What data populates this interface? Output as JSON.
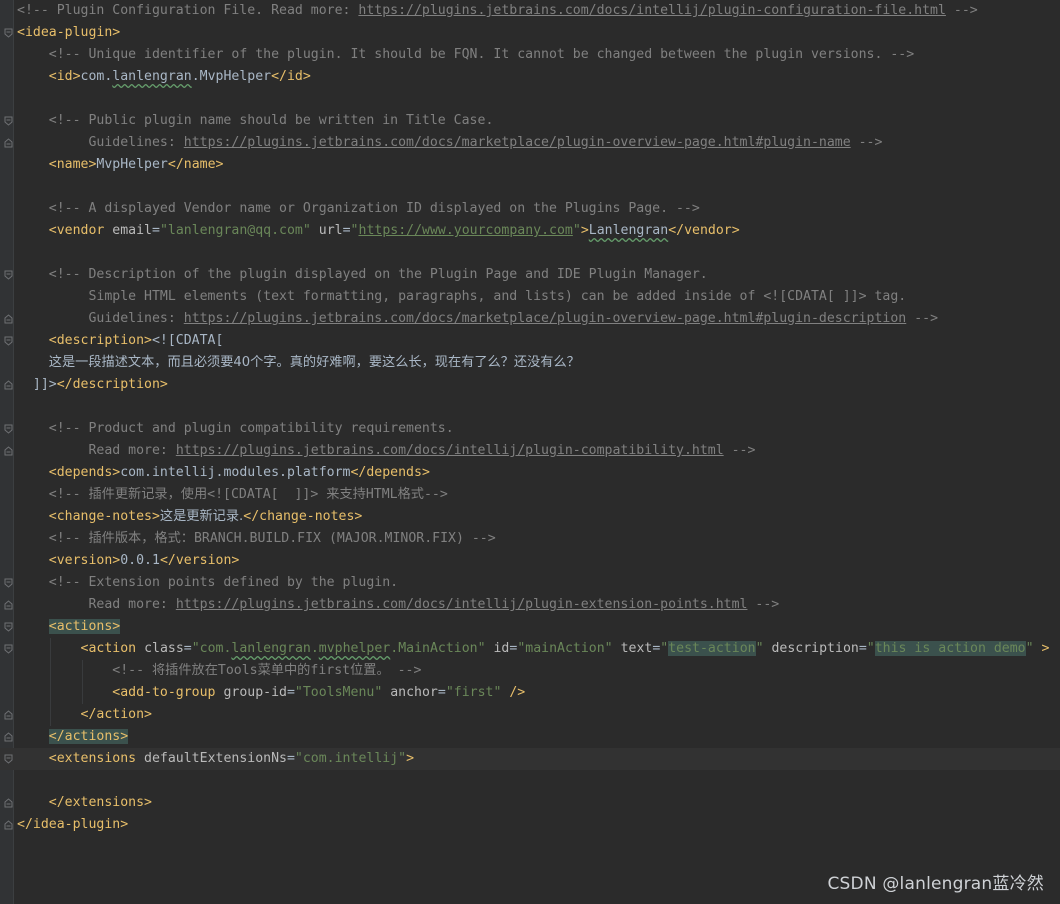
{
  "editor": {
    "language": "xml",
    "caret_line": 34,
    "lines": [
      [
        {
          "c": "cmt",
          "t": "<!-- Plugin Configuration File. Read more: "
        },
        {
          "c": "link",
          "t": "https://plugins.jetbrains.com/docs/intellij/plugin-configuration-file.html"
        },
        {
          "c": "cmt",
          "t": " -->"
        }
      ],
      [
        {
          "c": "tag",
          "t": "<idea-plugin>"
        }
      ],
      [
        {
          "c": "ws",
          "t": "    "
        },
        {
          "c": "cmt",
          "t": "<!-- Unique identifier of the plugin. It should be FQN. It cannot be changed between the plugin versions. -->"
        }
      ],
      [
        {
          "c": "ws",
          "t": "    "
        },
        {
          "c": "tag",
          "t": "<id>"
        },
        {
          "c": "text",
          "t": "com."
        },
        {
          "c": "typo",
          "t": "lanlengran"
        },
        {
          "c": "text",
          "t": ".MvpHelper"
        },
        {
          "c": "tag",
          "t": "</id>"
        }
      ],
      [],
      [
        {
          "c": "ws",
          "t": "    "
        },
        {
          "c": "cmt",
          "t": "<!-- Public plugin name should be written in Title Case."
        }
      ],
      [
        {
          "c": "ws",
          "t": "         "
        },
        {
          "c": "cmt",
          "t": "Guidelines: "
        },
        {
          "c": "link",
          "t": "https://plugins.jetbrains.com/docs/marketplace/plugin-overview-page.html#plugin-name"
        },
        {
          "c": "cmt",
          "t": " -->"
        }
      ],
      [
        {
          "c": "ws",
          "t": "    "
        },
        {
          "c": "tag",
          "t": "<name>"
        },
        {
          "c": "text",
          "t": "MvpHelper"
        },
        {
          "c": "tag",
          "t": "</name>"
        }
      ],
      [],
      [
        {
          "c": "ws",
          "t": "    "
        },
        {
          "c": "cmt",
          "t": "<!-- A displayed Vendor name or Organization ID displayed on the Plugins Page. -->"
        }
      ],
      [
        {
          "c": "ws",
          "t": "    "
        },
        {
          "c": "tag",
          "t": "<vendor "
        },
        {
          "c": "attr",
          "t": "email"
        },
        {
          "c": "text",
          "t": "="
        },
        {
          "c": "val",
          "t": "\"lanlengran@qq.com\""
        },
        {
          "c": "text",
          "t": " "
        },
        {
          "c": "attr",
          "t": "url"
        },
        {
          "c": "text",
          "t": "="
        },
        {
          "c": "val",
          "t": "\""
        },
        {
          "c": "linkval",
          "t": "https://www.yourcompany.com"
        },
        {
          "c": "val",
          "t": "\""
        },
        {
          "c": "tag",
          "t": ">"
        },
        {
          "c": "typo",
          "t": "Lanlengran"
        },
        {
          "c": "tag",
          "t": "</vendor>"
        }
      ],
      [],
      [
        {
          "c": "ws",
          "t": "    "
        },
        {
          "c": "cmt",
          "t": "<!-- Description of the plugin displayed on the Plugin Page and IDE Plugin Manager."
        }
      ],
      [
        {
          "c": "ws",
          "t": "         "
        },
        {
          "c": "cmt",
          "t": "Simple HTML elements (text formatting, paragraphs, and lists) can be added inside of <![CDATA[ ]]> tag."
        }
      ],
      [
        {
          "c": "ws",
          "t": "         "
        },
        {
          "c": "cmt",
          "t": "Guidelines: "
        },
        {
          "c": "link",
          "t": "https://plugins.jetbrains.com/docs/marketplace/plugin-overview-page.html#plugin-description"
        },
        {
          "c": "cmt",
          "t": " -->"
        }
      ],
      [
        {
          "c": "ws",
          "t": "    "
        },
        {
          "c": "tag",
          "t": "<description>"
        },
        {
          "c": "text",
          "t": "<![CDATA["
        }
      ],
      [
        {
          "c": "ws",
          "t": "    "
        },
        {
          "c": "cjk",
          "t": "这是一段描述文本，而且必须要40个字。真的好难啊，要这么长，现在有了么？还没有么？"
        }
      ],
      [
        {
          "c": "ws",
          "t": "  "
        },
        {
          "c": "text",
          "t": "]]>"
        },
        {
          "c": "tag",
          "t": "</description>"
        }
      ],
      [],
      [
        {
          "c": "ws",
          "t": "    "
        },
        {
          "c": "cmt",
          "t": "<!-- Product and plugin compatibility requirements."
        }
      ],
      [
        {
          "c": "ws",
          "t": "         "
        },
        {
          "c": "cmt",
          "t": "Read more: "
        },
        {
          "c": "link",
          "t": "https://plugins.jetbrains.com/docs/intellij/plugin-compatibility.html"
        },
        {
          "c": "cmt",
          "t": " -->"
        }
      ],
      [
        {
          "c": "ws",
          "t": "    "
        },
        {
          "c": "tag",
          "t": "<depends>"
        },
        {
          "c": "text",
          "t": "com.intellij.modules.platform"
        },
        {
          "c": "tag",
          "t": "</depends>"
        }
      ],
      [
        {
          "c": "ws",
          "t": "    "
        },
        {
          "c": "cmt",
          "t": "<!-- "
        },
        {
          "c": "cmtcjk",
          "t": "插件更新记录，使用"
        },
        {
          "c": "cmt",
          "t": "<![CDATA[  ]]> "
        },
        {
          "c": "cmtcjk",
          "t": "来支持"
        },
        {
          "c": "cmt",
          "t": "HTML"
        },
        {
          "c": "cmtcjk",
          "t": "格式"
        },
        {
          "c": "cmt",
          "t": "-->"
        }
      ],
      [
        {
          "c": "ws",
          "t": "    "
        },
        {
          "c": "tag",
          "t": "<change-notes>"
        },
        {
          "c": "cjk",
          "t": "这是更新记录."
        },
        {
          "c": "tag",
          "t": "</change-notes>"
        }
      ],
      [
        {
          "c": "ws",
          "t": "    "
        },
        {
          "c": "cmt",
          "t": "<!-- "
        },
        {
          "c": "cmtcjk",
          "t": "插件版本，格式："
        },
        {
          "c": "cmt",
          "t": "BRANCH.BUILD.FIX (MAJOR.MINOR.FIX) -->"
        }
      ],
      [
        {
          "c": "ws",
          "t": "    "
        },
        {
          "c": "tag",
          "t": "<version>"
        },
        {
          "c": "text",
          "t": "0.0.1"
        },
        {
          "c": "tag",
          "t": "</version>"
        }
      ],
      [
        {
          "c": "ws",
          "t": "    "
        },
        {
          "c": "cmt",
          "t": "<!-- Extension points defined by the plugin."
        }
      ],
      [
        {
          "c": "ws",
          "t": "         "
        },
        {
          "c": "cmt",
          "t": "Read more: "
        },
        {
          "c": "link",
          "t": "https://plugins.jetbrains.com/docs/intellij/plugin-extension-points.html"
        },
        {
          "c": "cmt",
          "t": " -->"
        }
      ],
      [
        {
          "c": "ws",
          "t": "    "
        },
        {
          "c": "tagmatch",
          "t": "<actions>"
        }
      ],
      [
        {
          "c": "ws",
          "t": "        "
        },
        {
          "c": "tag",
          "t": "<action "
        },
        {
          "c": "attr",
          "t": "class"
        },
        {
          "c": "text",
          "t": "="
        },
        {
          "c": "val",
          "t": "\"com."
        },
        {
          "c": "valtypo",
          "t": "lanlengran"
        },
        {
          "c": "val",
          "t": "."
        },
        {
          "c": "valtypo",
          "t": "mvphelper"
        },
        {
          "c": "val",
          "t": ".MainAction\""
        },
        {
          "c": "text",
          "t": " "
        },
        {
          "c": "attr",
          "t": "id"
        },
        {
          "c": "text",
          "t": "="
        },
        {
          "c": "val",
          "t": "\"mainAction\""
        },
        {
          "c": "text",
          "t": " "
        },
        {
          "c": "attr",
          "t": "text"
        },
        {
          "c": "text",
          "t": "="
        },
        {
          "c": "val",
          "t": "\""
        },
        {
          "c": "valhl",
          "t": "test-action"
        },
        {
          "c": "val",
          "t": "\""
        },
        {
          "c": "text",
          "t": " "
        },
        {
          "c": "attr",
          "t": "description"
        },
        {
          "c": "text",
          "t": "="
        },
        {
          "c": "val",
          "t": "\""
        },
        {
          "c": "valhl",
          "t": "this is action demo"
        },
        {
          "c": "val",
          "t": "\""
        },
        {
          "c": "text",
          "t": " "
        },
        {
          "c": "tag",
          "t": ">"
        }
      ],
      [
        {
          "c": "ws",
          "t": "            "
        },
        {
          "c": "cmt",
          "t": "<!-- "
        },
        {
          "c": "cmtcjk",
          "t": "将插件放在"
        },
        {
          "c": "cmt",
          "t": "Tools"
        },
        {
          "c": "cmtcjk",
          "t": "菜单中的"
        },
        {
          "c": "cmt",
          "t": "first"
        },
        {
          "c": "cmtcjk",
          "t": "位置。"
        },
        {
          "c": "cmt",
          "t": " -->"
        }
      ],
      [
        {
          "c": "ws",
          "t": "            "
        },
        {
          "c": "tag",
          "t": "<add-to-group "
        },
        {
          "c": "attr",
          "t": "group-id"
        },
        {
          "c": "text",
          "t": "="
        },
        {
          "c": "val",
          "t": "\"ToolsMenu\""
        },
        {
          "c": "text",
          "t": " "
        },
        {
          "c": "attr",
          "t": "anchor"
        },
        {
          "c": "text",
          "t": "="
        },
        {
          "c": "val",
          "t": "\"first\""
        },
        {
          "c": "text",
          "t": " "
        },
        {
          "c": "tag",
          "t": "/>"
        }
      ],
      [
        {
          "c": "ws",
          "t": "        "
        },
        {
          "c": "tag",
          "t": "</action>"
        }
      ],
      [
        {
          "c": "ws",
          "t": "    "
        },
        {
          "c": "tagmatch",
          "t": "</actions>"
        }
      ],
      [
        {
          "c": "ws",
          "t": "    "
        },
        {
          "c": "tag",
          "t": "<extensions "
        },
        {
          "c": "attr",
          "t": "defaultExtensionNs"
        },
        {
          "c": "text",
          "t": "="
        },
        {
          "c": "val",
          "t": "\"com.intellij\""
        },
        {
          "c": "tag",
          "t": ">"
        }
      ],
      [],
      [
        {
          "c": "ws",
          "t": "    "
        },
        {
          "c": "tag",
          "t": "</extensions>"
        }
      ],
      [
        {
          "c": "tag",
          "t": "</idea-plugin>"
        }
      ]
    ]
  },
  "watermark": "CSDN @lanlengran蓝冷然",
  "colors": {
    "background": "#2b2b2b",
    "gutter": "#313335",
    "tag": "#e8bf6a",
    "attribute": "#bababa",
    "value": "#6a8759",
    "comment": "#808080",
    "text": "#a9b7c6",
    "match_highlight": "#3b514d",
    "caret_row": "#323232"
  },
  "icons": {
    "fold_open": "fold-open-icon",
    "fold_close": "fold-close-icon"
  }
}
